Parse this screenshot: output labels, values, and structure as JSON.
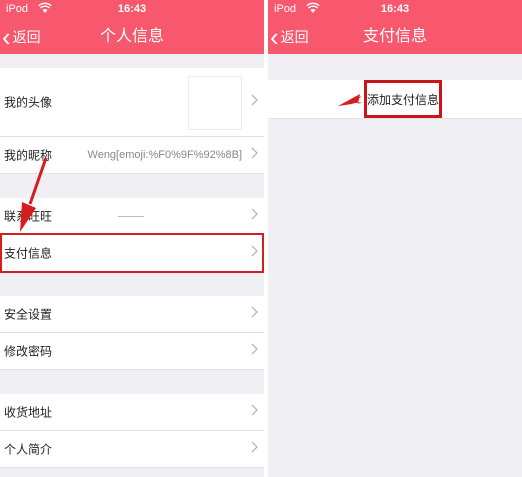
{
  "left_screen": {
    "status": {
      "carrier": "iPod",
      "time": "16:43"
    },
    "nav": {
      "back": "返回",
      "title": "个人信息"
    },
    "rows": {
      "avatar": "我的头像",
      "nickname": "我的昵称",
      "nickname_value": "Weng[emoji:%F0%9F%92%8B]",
      "wangwang": "联系旺旺",
      "payment": "支付信息",
      "security": "安全设置",
      "password": "修改密码",
      "address": "收货地址",
      "intro": "个人简介"
    }
  },
  "right_screen": {
    "status": {
      "carrier": "iPod",
      "time": "16:43"
    },
    "nav": {
      "back": "返回",
      "title": "支付信息"
    },
    "add_button": "添加支付信息"
  },
  "colors": {
    "accent": "#f7586d",
    "annotation": "#d71d1d"
  }
}
